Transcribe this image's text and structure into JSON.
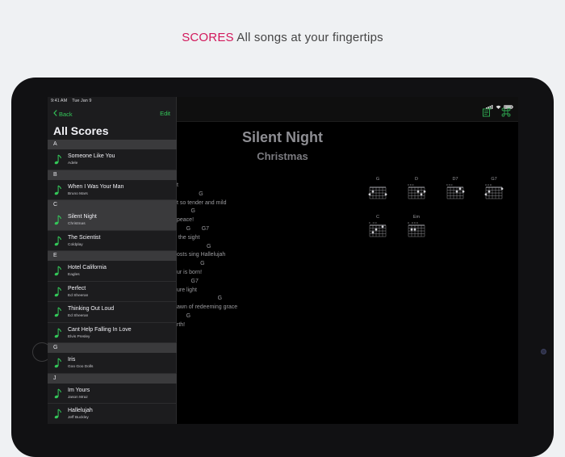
{
  "headline": {
    "accent": "SCORES",
    "text": " All songs at your fingertips"
  },
  "status": {
    "time": "9:41 AM",
    "date": "Tue Jan 9"
  },
  "sidebar": {
    "back_label": "Back",
    "edit_label": "Edit",
    "title": "All Scores",
    "sections": [
      {
        "letter": "A",
        "songs": [
          {
            "title": "Someone Like You",
            "artist": "Adele"
          }
        ]
      },
      {
        "letter": "B",
        "songs": [
          {
            "title": "When I Was Your Man",
            "artist": "Bruno Mars"
          }
        ]
      },
      {
        "letter": "C",
        "songs": [
          {
            "title": "Silent Night",
            "artist": "Christmas",
            "selected": true
          },
          {
            "title": "The Scientist",
            "artist": "Coldplay"
          }
        ]
      },
      {
        "letter": "E",
        "songs": [
          {
            "title": "Hotel California",
            "artist": "Eagles"
          },
          {
            "title": "Perfect",
            "artist": "Ed Sheeran"
          },
          {
            "title": "Thinking Out Loud",
            "artist": "Ed Sheeran"
          },
          {
            "title": "Cant Help Falling In Love",
            "artist": "Elvis Presley"
          }
        ]
      },
      {
        "letter": "G",
        "songs": [
          {
            "title": "Iris",
            "artist": "Goo Goo Dolls"
          }
        ]
      },
      {
        "letter": "J",
        "songs": [
          {
            "title": "Im Yours",
            "artist": "Jason Mraz"
          },
          {
            "title": "Hallelujah",
            "artist": "Jeff Buckley"
          }
        ]
      }
    ]
  },
  "score": {
    "title": "Silent Night",
    "subtitle": "Christmas",
    "lines": [
      "t",
      "              G",
      "t so tender and mild",
      "         G",
      "peace!",
      "      G       G7",
      " the sight",
      "                   G",
      "osts sing Hallelujah",
      "               G",
      "ur is born!",
      "         G7",
      "ure light",
      "                          G",
      "awn of redeeming grace",
      "      G",
      "rth!"
    ],
    "chords": [
      {
        "name": "G",
        "top": "",
        "dots": [
          [
            0,
            3
          ],
          [
            1,
            2
          ],
          [
            5,
            3
          ]
        ]
      },
      {
        "name": "D",
        "top": "x x o",
        "dots": [
          [
            3,
            2
          ],
          [
            4,
            3
          ],
          [
            5,
            2
          ]
        ]
      },
      {
        "name": "D7",
        "top": "x x o",
        "dots": [
          [
            3,
            2
          ],
          [
            4,
            1
          ],
          [
            5,
            2
          ]
        ]
      },
      {
        "name": "G7",
        "top": "o o o",
        "dots": [
          [
            0,
            3
          ],
          [
            1,
            2
          ],
          [
            5,
            1
          ]
        ]
      },
      {
        "name": "C",
        "top": "x   o o",
        "dots": [
          [
            1,
            3
          ],
          [
            2,
            2
          ],
          [
            4,
            1
          ]
        ]
      },
      {
        "name": "Em",
        "top": "o   o o o",
        "dots": [
          [
            1,
            2
          ],
          [
            2,
            2
          ]
        ]
      }
    ]
  },
  "colors": {
    "accent": "#d2185b",
    "tint": "#34c759"
  }
}
